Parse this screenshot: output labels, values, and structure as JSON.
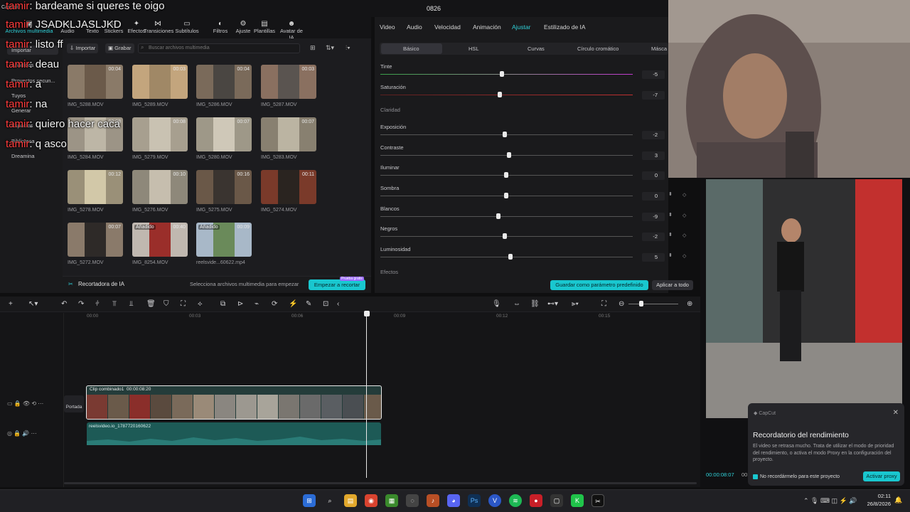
{
  "window": {
    "title": "0826",
    "logo": "CapCut"
  },
  "toolbar": {
    "items": [
      {
        "label": "Archivos multimedia",
        "icon": "media-icon"
      },
      {
        "label": "Audio",
        "icon": "audio-icon"
      },
      {
        "label": "Texto",
        "icon": "text-icon"
      },
      {
        "label": "Stickers",
        "icon": "sticker-icon"
      },
      {
        "label": "Efectos",
        "icon": "effects-icon"
      },
      {
        "label": "Transiciones",
        "icon": "transition-icon"
      },
      {
        "label": "Subtítulos",
        "icon": "subtitle-icon"
      },
      {
        "label": "Filtros",
        "icon": "filter-icon"
      },
      {
        "label": "Ajuste",
        "icon": "adjust-icon"
      },
      {
        "label": "Plantillas",
        "icon": "template-icon"
      },
      {
        "label": "Avatar de IA",
        "icon": "avatar-icon"
      }
    ]
  },
  "leftnav": {
    "items": [
      "Importar",
      "Añadidos",
      "Proyectos secun...",
      "Tuyos",
      "Generar",
      "Espacios",
      "Biblioteca",
      "Dreamina"
    ]
  },
  "media": {
    "import_label": "Importar",
    "record_label": "Grabar",
    "search_placeholder": "Buscar archivos multimedia",
    "clips": [
      {
        "name": "IMG_5288.MOV",
        "duration": "00:04",
        "tag": ""
      },
      {
        "name": "IMG_5289.MOV",
        "duration": "00:03",
        "tag": ""
      },
      {
        "name": "IMG_5286.MOV",
        "duration": "00:04",
        "tag": ""
      },
      {
        "name": "IMG_5287.MOV",
        "duration": "00:03",
        "tag": ""
      },
      {
        "name": "IMG_5284.MOV",
        "duration": "00:08",
        "tag": ""
      },
      {
        "name": "IMG_5279.MOV",
        "duration": "00:08",
        "tag": ""
      },
      {
        "name": "IMG_5280.MOV",
        "duration": "00:07",
        "tag": ""
      },
      {
        "name": "IMG_5283.MOV",
        "duration": "00:07",
        "tag": ""
      },
      {
        "name": "IMG_5278.MOV",
        "duration": "00:12",
        "tag": ""
      },
      {
        "name": "IMG_5276.MOV",
        "duration": "00:10",
        "tag": ""
      },
      {
        "name": "IMG_5275.MOV",
        "duration": "00:16",
        "tag": ""
      },
      {
        "name": "IMG_5274.MOV",
        "duration": "00:11",
        "tag": ""
      },
      {
        "name": "IMG_5272.MOV",
        "duration": "00:07",
        "tag": ""
      },
      {
        "name": "IMG_8254.MOV",
        "duration": "00:40",
        "tag": "Añadido"
      },
      {
        "name": "reelsvide...60622.mp4",
        "duration": "00:09",
        "tag": "Añadido"
      }
    ],
    "footer_title": "Recortadora de IA",
    "footer_hint": "Selecciona archivos multimedia para empezar",
    "footer_button": "Empezar a recortar",
    "footer_badge": "Prueba gratis"
  },
  "inspector": {
    "tabs": [
      "Video",
      "Audio",
      "Velocidad",
      "Animación",
      "Ajustar",
      "Estilizado de IA"
    ],
    "active_tab": "Ajustar",
    "subtabs": [
      "Básico",
      "HSL",
      "Curvas",
      "Círculo cromático",
      "Másca"
    ],
    "section_claridad": "Claridad",
    "section_efectos": "Efectos",
    "params": [
      {
        "label": "Tinte",
        "value": "-5",
        "v": -5
      },
      {
        "label": "Saturación",
        "value": "-7",
        "v": -7
      },
      {
        "label": "Exposición",
        "value": "-2",
        "v": -2
      },
      {
        "label": "Contraste",
        "value": "3",
        "v": 3
      },
      {
        "label": "Iluminar",
        "value": "0",
        "v": 0
      },
      {
        "label": "Sombra",
        "value": "0",
        "v": 0
      },
      {
        "label": "Blancos",
        "value": "-9",
        "v": -9
      },
      {
        "label": "Negros",
        "value": "-2",
        "v": -2
      },
      {
        "label": "Luminosidad",
        "value": "5",
        "v": 5
      }
    ],
    "save_preset": "Guardar como parámetro predefinido",
    "apply_all": "Aplicar a todo"
  },
  "timeline": {
    "ruler": [
      "00:00",
      "00:03",
      "00:06",
      "00:09",
      "00:12",
      "00:15"
    ],
    "cover_label": "Portada",
    "video_clip": {
      "name": "Clip combinado1",
      "duration": "00:00:08:20"
    },
    "audio_clip": {
      "name": "reelsvideo.io_1787720160622"
    }
  },
  "preview": {
    "timecode": "00:00:08:07",
    "trail": "00"
  },
  "toast": {
    "app": "CapCut",
    "title": "Recordatorio del rendimiento",
    "body": "El video se retrasa mucho. Trata de utilizar el modo de prioridad del rendimiento, o activa el modo Proxy en la configuración del proyecto.",
    "checkbox": "No recordármelo para este proyecto",
    "button": "Activar proxy"
  },
  "chat": [
    {
      "user": "tamir",
      "text": "bardeame si queres te oigo"
    },
    {
      "user": "tamir",
      "text": "JSADKLJASLJKD"
    },
    {
      "user": "tamir",
      "text": "listo ff"
    },
    {
      "user": "tamir",
      "text": "deau"
    },
    {
      "user": "tamir",
      "text": "a"
    },
    {
      "user": "tamir",
      "text": "na"
    },
    {
      "user": "tamir",
      "text": "quiero hacer caca"
    },
    {
      "user": "tamir",
      "text": "q asco"
    }
  ],
  "taskbar": {
    "time": "02:11",
    "date": "26/8/2026"
  },
  "colors": {
    "accent": "#19c7cf",
    "chat_user": "#ff3b3b"
  }
}
